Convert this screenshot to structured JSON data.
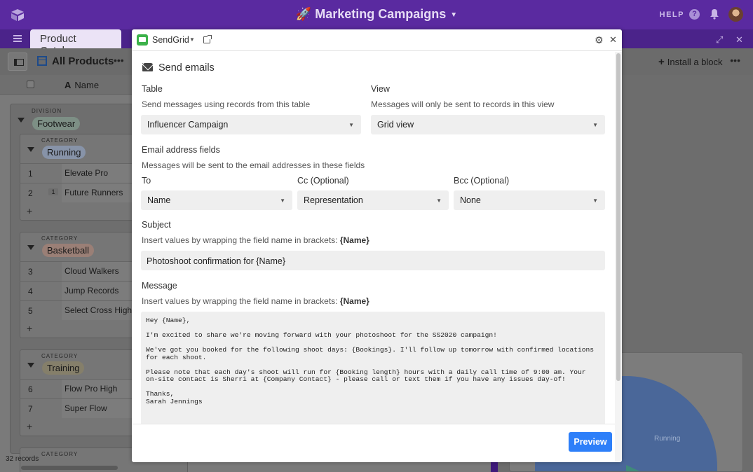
{
  "topbar": {
    "base_title": "🚀 Marketing Campaigns",
    "help_label": "HELP",
    "help_q": "?"
  },
  "tabbar": {
    "active_table": "Product Catalog"
  },
  "viewbar": {
    "view_name": "All Products",
    "more": "•••",
    "install_block": "Install a block"
  },
  "grid": {
    "name_header": "Name",
    "division_label": "DIVISION",
    "division_value": "Footwear",
    "category_label": "CATEGORY",
    "records": "32 records",
    "groups": [
      {
        "name": "Running",
        "rows": [
          {
            "num": "1",
            "count": "",
            "name": "Elevate Pro"
          },
          {
            "num": "2",
            "count": "1",
            "name": "Future Runners"
          }
        ]
      },
      {
        "name": "Basketball",
        "rows": [
          {
            "num": "3",
            "count": "",
            "name": "Cloud Walkers"
          },
          {
            "num": "4",
            "count": "",
            "name": "Jump Records"
          },
          {
            "num": "5",
            "count": "",
            "name": "Select Cross High"
          }
        ]
      },
      {
        "name": "Training",
        "rows": [
          {
            "num": "6",
            "count": "",
            "name": "Flow Pro High"
          },
          {
            "num": "7",
            "count": "",
            "name": "Super Flow"
          }
        ]
      }
    ],
    "next_category_label": "CATEGORY"
  },
  "chart": {
    "pie_label": "Running"
  },
  "modal": {
    "app_name": "SendGrid",
    "section_title": "Send emails",
    "table_label": "Table",
    "table_hint": "Send messages using records from this table",
    "table_value": "Influencer Campaign",
    "view_label": "View",
    "view_hint": "Messages will only be sent to records in this view",
    "view_value": "Grid view",
    "email_fields_label": "Email address fields",
    "email_fields_hint": "Messages will be sent to the email addresses in these fields",
    "to_label": "To",
    "to_value": "Name",
    "cc_label": "Cc (Optional)",
    "cc_value": "Representation",
    "bcc_label": "Bcc (Optional)",
    "bcc_value": "None",
    "subject_label": "Subject",
    "subject_hint": "Insert values by wrapping the field name in brackets:",
    "subject_hint_token": "{Name}",
    "subject_value": "Photoshoot confirmation for {Name}",
    "message_label": "Message",
    "message_hint": "Insert values by wrapping the field name in brackets:",
    "message_hint_token": "{Name}",
    "message_value": "Hey {Name},\n\nI'm excited to share we're moving forward with your photoshoot for the SS2020 campaign!\n\nWe've got you booked for the following shoot days: {Bookings}. I'll follow up tomorrow with confirmed locations for each shoot.\n\nPlease note that each day's shoot will run for {Booking length} hours with a daily call time of 9:00 am. Your on-site contact is Sherri at {Company Contact} - please call or text them if you have any issues day-of!\n\nThanks,\nSarah Jennings",
    "preview_label": "Preview"
  }
}
